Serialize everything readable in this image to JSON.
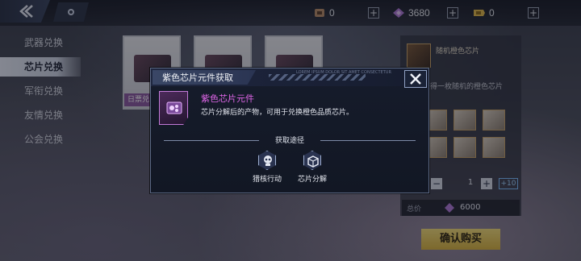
{
  "topbar": {
    "resources": [
      {
        "icon": "chip-token-icon",
        "value": "0",
        "color": "#b98f6a"
      },
      {
        "icon": "purple-gem-icon",
        "value": "3680",
        "color": "#b07ad8"
      },
      {
        "icon": "gold-ticket-icon",
        "value": "0",
        "color": "#e0b84a"
      }
    ],
    "plus_label": "+"
  },
  "nav": {
    "items": [
      {
        "label": "武器兑换",
        "active": false
      },
      {
        "label": "芯片兑换",
        "active": true
      },
      {
        "label": "军衔兑换",
        "active": false
      },
      {
        "label": "友情兑换",
        "active": false
      },
      {
        "label": "公会兑换",
        "active": false
      }
    ]
  },
  "background_cards": [
    {
      "label": "日票兑"
    },
    {
      "label": ""
    },
    {
      "label": ""
    }
  ],
  "right_panel": {
    "title": "随机橙色芯片",
    "desc": "随机获得一枚随机的橙色芯片",
    "quantity": "1",
    "minus": "−",
    "plus": "+",
    "plus10": "+10",
    "price_label": "总价",
    "price": "6000",
    "buy_label": "确认购买"
  },
  "dialog": {
    "title": "紫色芯片元件获取",
    "tiny_text": "LOREM IPSUM DOLOR SIT AMET CONSECTETUR",
    "item_name": "紫色芯片元件",
    "item_desc": "芯片分解后的产物，可用于兑换橙色品质芯片。",
    "section_label": "获取途径",
    "sources": [
      {
        "label": "猎核行动",
        "icon": "skull-hex-icon"
      },
      {
        "label": "芯片分解",
        "icon": "box-hex-icon"
      }
    ],
    "accent_color": "#e066e8"
  }
}
